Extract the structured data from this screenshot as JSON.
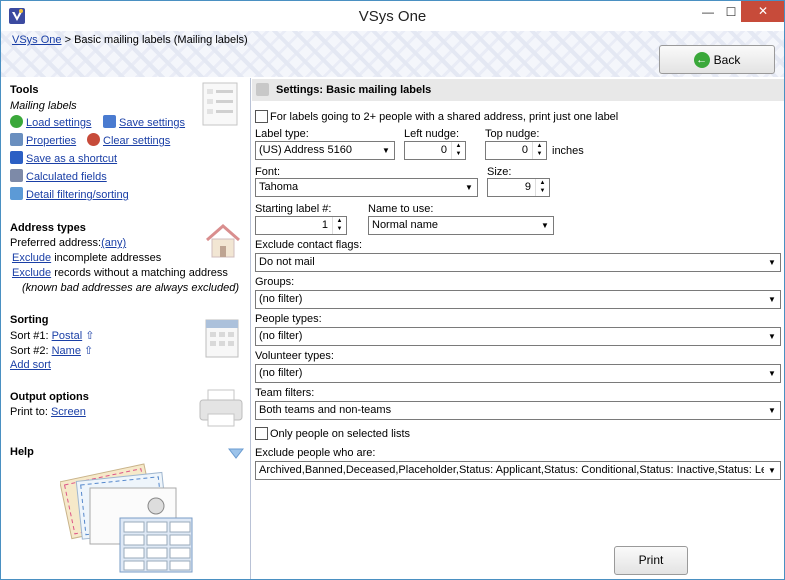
{
  "window": {
    "title": "VSys One",
    "min": "—",
    "max": "☐",
    "close": "✕"
  },
  "header": {
    "crumb_link": "VSys One",
    "crumb_sep": ">",
    "crumb_current": "Basic mailing labels (Mailing labels)",
    "back_label": "Back"
  },
  "tools": {
    "title": "Tools",
    "subtitle": "Mailing labels",
    "load": "Load settings",
    "save": "Save settings",
    "properties": "Properties",
    "clear": "Clear settings",
    "shortcut": "Save as a shortcut",
    "calc": "Calculated fields",
    "detail": "Detail filtering/sorting"
  },
  "address": {
    "title": "Address types",
    "preferred_label": "Preferred address:",
    "preferred_value": "(any)",
    "excl1_link": "Exclude",
    "excl1_text": "incomplete addresses",
    "excl2_link": "Exclude",
    "excl2_text": "records without a matching address",
    "note": "(known bad addresses are always excluded)"
  },
  "sorting": {
    "title": "Sorting",
    "sort1_label": "Sort #1:",
    "sort1_value": "Postal",
    "sort2_label": "Sort #2:",
    "sort2_value": "Name",
    "add": "Add sort",
    "arrow": "⇧"
  },
  "output": {
    "title": "Output options",
    "print_to_label": "Print to:",
    "print_to_value": "Screen"
  },
  "help": {
    "title": "Help"
  },
  "settings": {
    "title": "Settings: Basic mailing labels",
    "shared_address": "For labels going to 2+ people with a shared address, print just one label",
    "label_type_label": "Label type:",
    "label_type_value": "(US) Address 5160",
    "left_nudge_label": "Left nudge:",
    "left_nudge_value": "0",
    "top_nudge_label": "Top nudge:",
    "top_nudge_value": "0",
    "inches": "inches",
    "font_label": "Font:",
    "font_value": "Tahoma",
    "size_label": "Size:",
    "size_value": "9",
    "starting_label": "Starting label #:",
    "starting_value": "1",
    "name_label": "Name to use:",
    "name_value": "Normal name",
    "exclude_flags_label": "Exclude contact flags:",
    "exclude_flags_value": "Do not mail",
    "groups_label": "Groups:",
    "groups_value": "(no filter)",
    "people_types_label": "People types:",
    "people_types_value": "(no filter)",
    "volunteer_types_label": "Volunteer types:",
    "volunteer_types_value": "(no filter)",
    "team_filters_label": "Team filters:",
    "team_filters_value": "Both teams and non-teams",
    "selected_lists": "Only people on selected lists",
    "exclude_people_label": "Exclude people who are:",
    "exclude_people_value": "Archived,Banned,Deceased,Placeholder,Status: Applicant,Status: Conditional,Status: Inactive,Status: Le",
    "print_label": "Print"
  },
  "colors": {
    "accent": "#1a3fa6",
    "close": "#c74b3a",
    "section_head": "#e8e8e8"
  }
}
